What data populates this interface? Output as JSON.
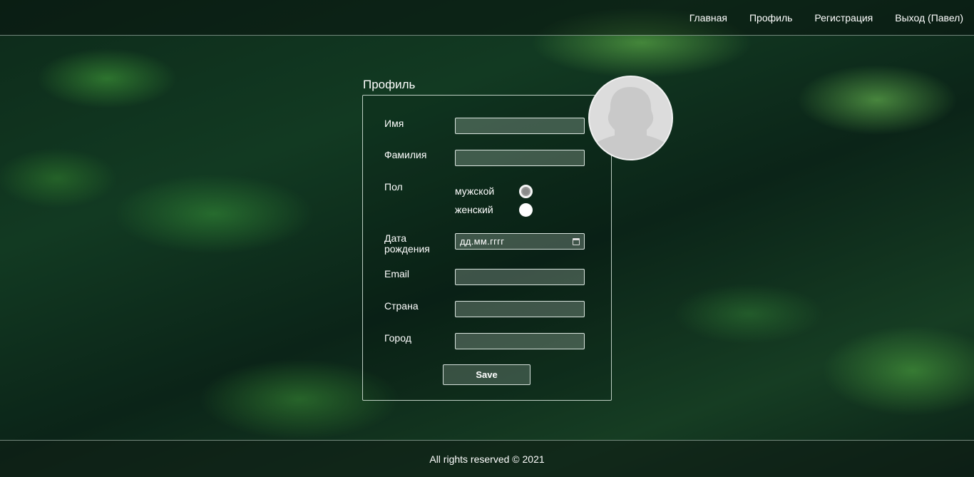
{
  "nav": {
    "items": [
      {
        "label": "Главная"
      },
      {
        "label": "Профиль"
      },
      {
        "label": "Регистрация"
      },
      {
        "label": "Выход (Павел)"
      }
    ]
  },
  "profile": {
    "title": "Профиль",
    "fields": {
      "first_name": {
        "label": "Имя",
        "value": ""
      },
      "last_name": {
        "label": "Фамилия",
        "value": ""
      },
      "gender": {
        "label": "Пол",
        "options": [
          "мужской",
          "женский"
        ],
        "selected": "мужской"
      },
      "birth_date": {
        "label_line1": "Дата",
        "label_line2": "рождения",
        "placeholder": "дд.мм.гггг"
      },
      "email": {
        "label": "Email",
        "value": ""
      },
      "country": {
        "label": "Страна",
        "value": ""
      },
      "city": {
        "label": "Город",
        "value": ""
      }
    },
    "save_label": "Save",
    "avatar_icon": "person-silhouette-icon"
  },
  "footer": {
    "text": "All rights reserved © 2021"
  },
  "colors": {
    "background": "#0f2f1c",
    "foliage": "#4caf50",
    "border": "#e0ece4",
    "avatar_bg": "#dcdcdc"
  }
}
